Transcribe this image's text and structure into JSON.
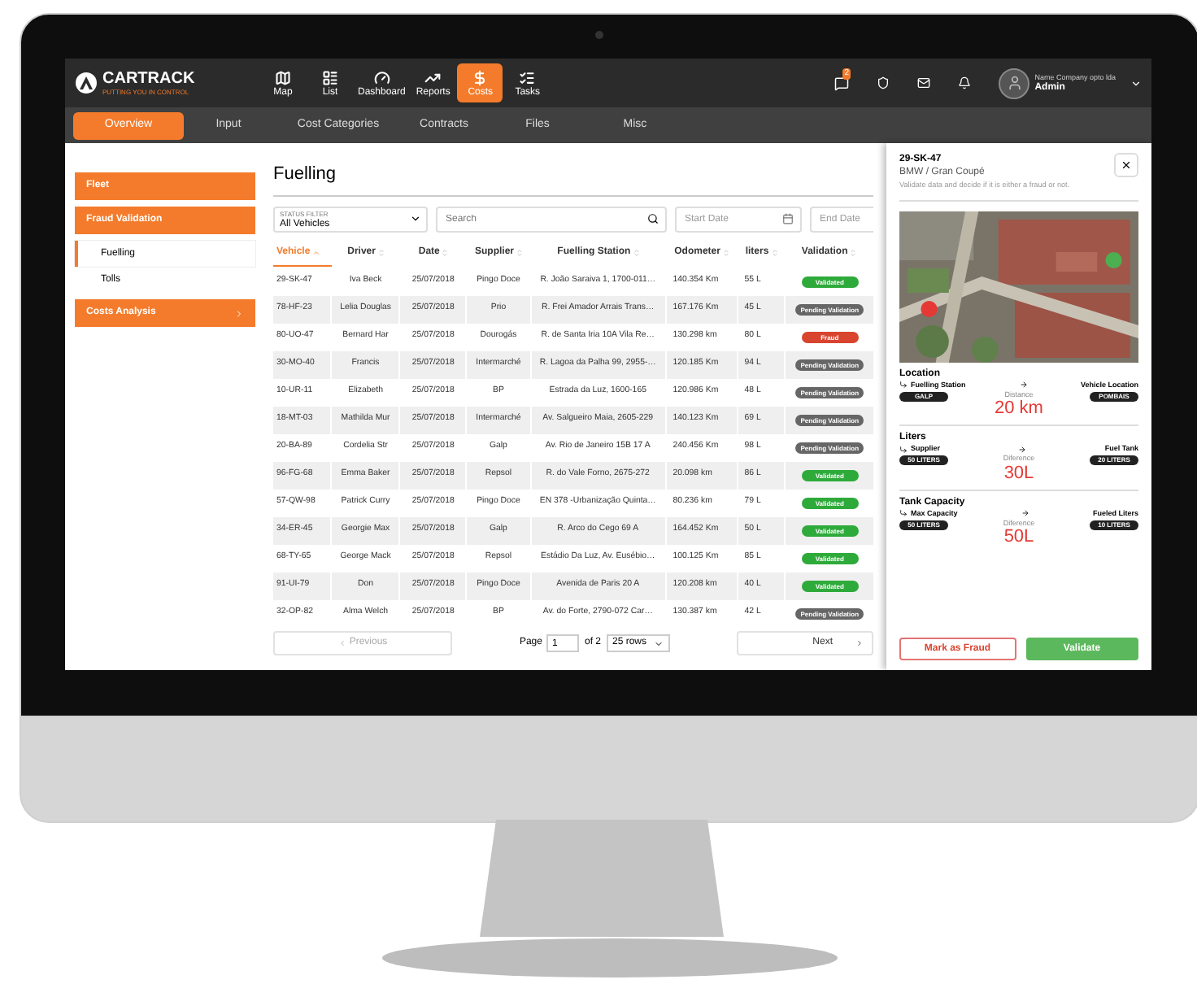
{
  "brand": {
    "name": "CARTRACK",
    "tagline": "PUTTING YOU IN CONTROL"
  },
  "nav": [
    {
      "label": "Map",
      "selected": false
    },
    {
      "label": "List",
      "selected": false
    },
    {
      "label": "Dashboard",
      "selected": false
    },
    {
      "label": "Reports",
      "selected": false
    },
    {
      "label": "Costs",
      "selected": true
    },
    {
      "label": "Tasks",
      "selected": false
    }
  ],
  "header": {
    "notification_count": "2",
    "company": "Name Company opto lda",
    "user": "Admin"
  },
  "tabs": [
    {
      "label": "Overview",
      "selected": true
    },
    {
      "label": "Input",
      "selected": false
    },
    {
      "label": "Cost Categories",
      "selected": false
    },
    {
      "label": "Contracts",
      "selected": false
    },
    {
      "label": "Files",
      "selected": false
    },
    {
      "label": "Misc",
      "selected": false
    }
  ],
  "sidebar": {
    "items": [
      {
        "label": "Fleet",
        "has_chevron": false
      },
      {
        "label": "Fraud Validation",
        "has_chevron": false,
        "children": [
          {
            "label": "Fuelling",
            "selected": true
          },
          {
            "label": "Tolls",
            "selected": false
          }
        ]
      },
      {
        "label": "Costs Analysis",
        "has_chevron": true
      }
    ]
  },
  "page_title": "Fuelling",
  "filters": {
    "status_label": "STATUS FILTER",
    "status_value": "All Vehicles",
    "search_placeholder": "Search",
    "start_date_placeholder": "Start Date",
    "end_date_placeholder": "End Date"
  },
  "table": {
    "columns": [
      {
        "label": "Vehicle",
        "sorted": true
      },
      {
        "label": "Driver",
        "sorted": false
      },
      {
        "label": "Date",
        "sorted": false
      },
      {
        "label": "Supplier",
        "sorted": false
      },
      {
        "label": "Fuelling Station",
        "sorted": false
      },
      {
        "label": "Odometer",
        "sorted": false
      },
      {
        "label": "liters",
        "sorted": false
      },
      {
        "label": "Validation",
        "sorted": false
      }
    ],
    "rows": [
      {
        "cells": [
          "29-SK-47",
          "Iva Beck",
          "25/07/2018",
          "Pingo Doce",
          "R. João Saraiva 1, 1700-011…",
          "140.354 Km",
          "55 L"
        ],
        "validation": {
          "kind": "validated",
          "label": "Validated"
        }
      },
      {
        "cells": [
          "78-HF-23",
          "Lelia Douglas",
          "25/07/2018",
          "Prio",
          "R. Frei Amador Arrais Trans…",
          "167.176 Km",
          "45 L"
        ],
        "validation": {
          "kind": "pending",
          "label": "Pending Validation"
        }
      },
      {
        "cells": [
          "80-UO-47",
          "Bernard Har",
          "25/07/2018",
          "Dourogás",
          "R. de Santa Iria 10A Vila Re…",
          "130.298 km",
          "80 L"
        ],
        "validation": {
          "kind": "fraud",
          "label": "Fraud"
        }
      },
      {
        "cells": [
          "30-MO-40",
          "Francis",
          "25/07/2018",
          "Intermarché",
          "R. Lagoa da Palha 99, 2955-…",
          "120.185 Km",
          "94 L"
        ],
        "validation": {
          "kind": "pending",
          "label": "Pending Validation"
        }
      },
      {
        "cells": [
          "10-UR-11",
          "Elizabeth",
          "25/07/2018",
          "BP",
          "Estrada da Luz, 1600-165",
          "120.986 Km",
          "48 L"
        ],
        "validation": {
          "kind": "pending",
          "label": "Pending Validation"
        }
      },
      {
        "cells": [
          "18-MT-03",
          "Mathilda Mur",
          "25/07/2018",
          "Intermarché",
          "Av. Salgueiro Maia, 2605-229",
          "140.123 Km",
          "69 L"
        ],
        "validation": {
          "kind": "pending",
          "label": "Pending Validation"
        }
      },
      {
        "cells": [
          "20-BA-89",
          "Cordelia Str",
          "25/07/2018",
          "Galp",
          "Av. Rio de Janeiro 15B 17 A",
          "240.456 Km",
          "98 L"
        ],
        "validation": {
          "kind": "pending",
          "label": "Pending Validation"
        }
      },
      {
        "cells": [
          "96-FG-68",
          "Emma Baker",
          "25/07/2018",
          "Repsol",
          "R. do Vale Forno, 2675-272",
          "20.098 km",
          "86 L"
        ],
        "validation": {
          "kind": "validated",
          "label": "Validated"
        }
      },
      {
        "cells": [
          "57-QW-98",
          "Patrick Curry",
          "25/07/2018",
          "Pingo Doce",
          "EN 378 -Urbanização Quinta…",
          "80.236 km",
          "79 L"
        ],
        "validation": {
          "kind": "validated",
          "label": "Validated"
        }
      },
      {
        "cells": [
          "34-ER-45",
          "Georgie Max",
          "25/07/2018",
          "Galp",
          "R. Arco do Cego 69 A",
          "164.452 Km",
          "50 L"
        ],
        "validation": {
          "kind": "validated",
          "label": "Validated"
        }
      },
      {
        "cells": [
          "68-TY-65",
          "George Mack",
          "25/07/2018",
          "Repsol",
          "Estádio Da Luz, Av. Eusébio…",
          "100.125 Km",
          "85 L"
        ],
        "validation": {
          "kind": "validated",
          "label": "Validated"
        }
      },
      {
        "cells": [
          "91-UI-79",
          "Don",
          "25/07/2018",
          "Pingo Doce",
          "Avenida de Paris 20 A",
          "120.208 km",
          "40 L"
        ],
        "validation": {
          "kind": "validated",
          "label": "Validated"
        }
      },
      {
        "cells": [
          "32-OP-82",
          "Alma Welch",
          "25/07/2018",
          "BP",
          "Av. do Forte, 2790-072 Car…",
          "130.387 km",
          "42 L"
        ],
        "validation": {
          "kind": "pending",
          "label": "Pending Validation"
        }
      }
    ]
  },
  "pagination": {
    "previous": {
      "label": "Previous",
      "disabled": true
    },
    "page_label": "Page",
    "page": "1",
    "of": "of 2",
    "rows": "25 rows",
    "next": {
      "label": "Next",
      "disabled": false
    }
  },
  "detail": {
    "plate": "29-SK-47",
    "model": "BMW / Gran Coupé",
    "note": "Validate data and decide if it is either a fraud or not.",
    "sections": [
      {
        "title": "Location",
        "left_label": "Fuelling Station",
        "left_value": "GALP",
        "right_label": "Vehicle Location",
        "right_value": "POMBAIS",
        "diff_label": "Distance",
        "diff_value": "20 km"
      },
      {
        "title": "Liters",
        "left_label": "Supplier",
        "left_value": "50 LITERS",
        "right_label": "Fuel Tank",
        "right_value": "20 LITERS",
        "diff_label": "Diference",
        "diff_value": "30L"
      },
      {
        "title": "Tank Capacity",
        "left_label": "Max Capacity",
        "left_value": "50 LITERS",
        "right_label": "Fueled Liters",
        "right_value": "10 LITERS",
        "diff_label": "Diference",
        "diff_value": "50L"
      }
    ],
    "buttons": [
      {
        "label": "Mark as Fraud",
        "kind": "secondary"
      },
      {
        "label": "Validate",
        "kind": "primary"
      }
    ]
  }
}
